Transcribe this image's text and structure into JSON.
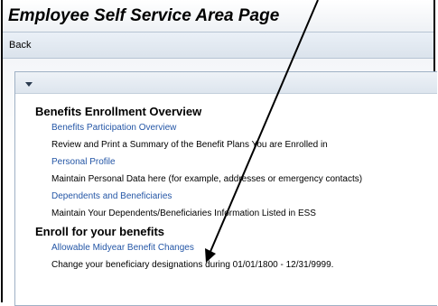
{
  "page": {
    "title": "Employee Self Service Area Page"
  },
  "toolbar": {
    "back_label": "Back"
  },
  "tray": {
    "toggle_icon": "triangle-down-icon"
  },
  "sections": [
    {
      "heading": "Benefits Enrollment Overview",
      "items": [
        {
          "link": "Benefits Participation Overview",
          "description": "Review and Print a Summary of the Benefit Plans You are Enrolled in"
        },
        {
          "link": "Personal Profile",
          "description": "Maintain Personal Data here (for example, addresses or emergency contacts)"
        },
        {
          "link": "Dependents and Beneficiaries",
          "description": "Maintain Your Dependents/Beneficiaries Information Listed in ESS"
        }
      ]
    },
    {
      "heading": "Enroll for your benefits",
      "items": [
        {
          "link": "Allowable Midyear Benefit Changes",
          "description": "Change your beneficiary designations during 01/01/1800 - 12/31/9999."
        }
      ]
    }
  ],
  "annotation": {
    "arrow_color": "#000000",
    "arrow_icon": "callout-arrow-icon"
  }
}
